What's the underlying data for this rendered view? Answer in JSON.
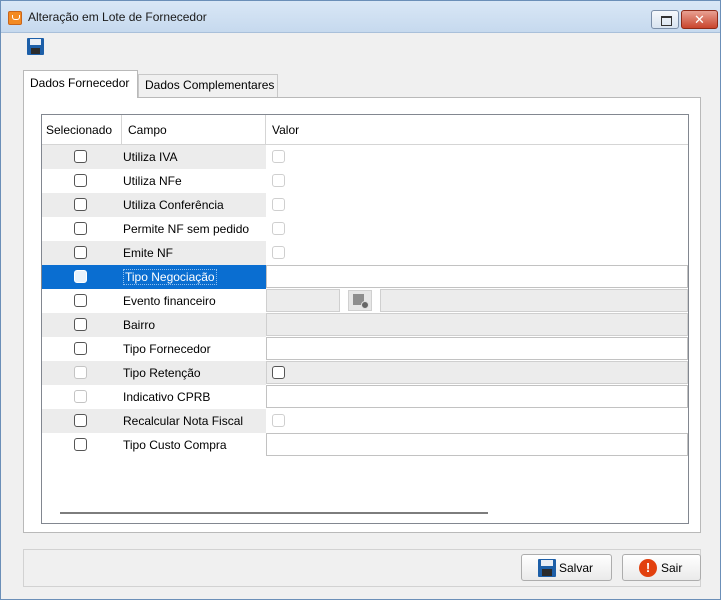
{
  "window": {
    "title": "Alteração em Lote de Fornecedor",
    "close_glyph": "✕"
  },
  "toolbar": {
    "save_icon": "save-icon"
  },
  "tabs": [
    {
      "label": "Dados Fornecedor",
      "active": true
    },
    {
      "label": "Dados Complementares",
      "active": false
    }
  ],
  "grid": {
    "columns": [
      "Selecionado",
      "Campo",
      "Valor"
    ],
    "rows": [
      {
        "campo": "Utiliza IVA",
        "valor_type": "checkbox"
      },
      {
        "campo": "Utiliza NFe",
        "valor_type": "checkbox"
      },
      {
        "campo": "Utiliza Conferência",
        "valor_type": "checkbox"
      },
      {
        "campo": "Permite NF sem pedido",
        "valor_type": "checkbox"
      },
      {
        "campo": "Emite NF",
        "valor_type": "checkbox"
      },
      {
        "campo": "Tipo Negociação",
        "valor_type": "text",
        "selected": true
      },
      {
        "campo": "Evento financeiro",
        "valor_type": "lookup"
      },
      {
        "campo": "Bairro",
        "valor_type": "text-gray"
      },
      {
        "campo": "Tipo Fornecedor",
        "valor_type": "text"
      },
      {
        "campo": "Tipo Retenção",
        "valor_type": "checkbox-dark"
      },
      {
        "campo": "Indicativo CPRB",
        "valor_type": "text",
        "selector_disabled": true
      },
      {
        "campo": "Recalcular Nota Fiscal",
        "valor_type": "checkbox"
      },
      {
        "campo": "Tipo Custo Compra",
        "valor_type": "text"
      }
    ]
  },
  "buttons": {
    "save_label": "Salvar",
    "exit_label": "Sair",
    "exit_glyph": "!"
  }
}
